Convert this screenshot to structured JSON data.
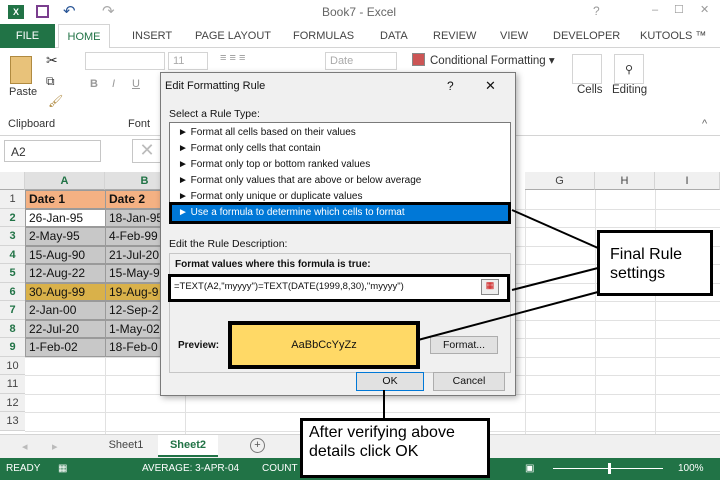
{
  "window": {
    "title": "Book7 - Excel",
    "help": "?",
    "minimize": "–",
    "maximize": "☐",
    "close": "✕"
  },
  "tabs": [
    "FILE",
    "HOME",
    "INSERT",
    "PAGE LAYOUT",
    "FORMULAS",
    "DATA",
    "REVIEW",
    "VIEW",
    "DEVELOPER",
    "KUTOOLS ™"
  ],
  "ribbon": {
    "paste": "Paste",
    "clipboard": "Clipboard",
    "font": "Font",
    "font_size": "11",
    "number_format": "Date",
    "conditional_formatting": "Conditional Formatting ▾",
    "cells": "Cells",
    "editing": "Editing"
  },
  "formula_bar": {
    "name_box": "A2"
  },
  "columns": [
    "A",
    "B",
    "G",
    "H",
    "I"
  ],
  "rows": [
    "1",
    "2",
    "3",
    "4",
    "5",
    "6",
    "7",
    "8",
    "9",
    "10",
    "11",
    "12",
    "13"
  ],
  "table": {
    "headers": [
      "Date 1",
      "Date 2"
    ],
    "rows": [
      [
        "26-Jan-95",
        "18-Jan-95"
      ],
      [
        "2-May-95",
        "4-Feb-99"
      ],
      [
        "15-Aug-90",
        "21-Jul-20"
      ],
      [
        "12-Aug-22",
        "15-May-9"
      ],
      [
        "30-Aug-99",
        "19-Aug-9"
      ],
      [
        "2-Jan-00",
        "12-Sep-2"
      ],
      [
        "22-Jul-20",
        "1-May-02"
      ],
      [
        "1-Feb-02",
        "18-Feb-0"
      ]
    ]
  },
  "dialog": {
    "title": "Edit Formatting Rule",
    "help": "?",
    "close": "✕",
    "select_label": "Select a Rule Type:",
    "rule_types": [
      "► Format all cells based on their values",
      "► Format only cells that contain",
      "► Format only top or bottom ranked values",
      "► Format only values that are above or below average",
      "► Format only unique or duplicate values",
      "► Use a formula to determine which cells to format"
    ],
    "edit_label": "Edit the Rule Description:",
    "formula_label": "Format values where this formula is true:",
    "formula": "=TEXT(A2,\"myyyy\")=TEXT(DATE(1999,8,30),\"myyyy\")",
    "preview_label": "Preview:",
    "preview_text": "AaBbCcYyZz",
    "format_button": "Format...",
    "ok": "OK",
    "cancel": "Cancel"
  },
  "callouts": {
    "final": "Final Rule settings",
    "verify": "After verifying above details click OK"
  },
  "sheets": [
    "Sheet1",
    "Sheet2"
  ],
  "status": {
    "ready": "READY",
    "average": "AVERAGE: 3-APR-04",
    "count": "COUNT",
    "zoom": "100%"
  },
  "colors": {
    "excel_green": "#217346",
    "header_fill": "#f4b183",
    "highlight": "#d9b14a",
    "preview": "#ffd966",
    "selection": "#0078d7"
  }
}
